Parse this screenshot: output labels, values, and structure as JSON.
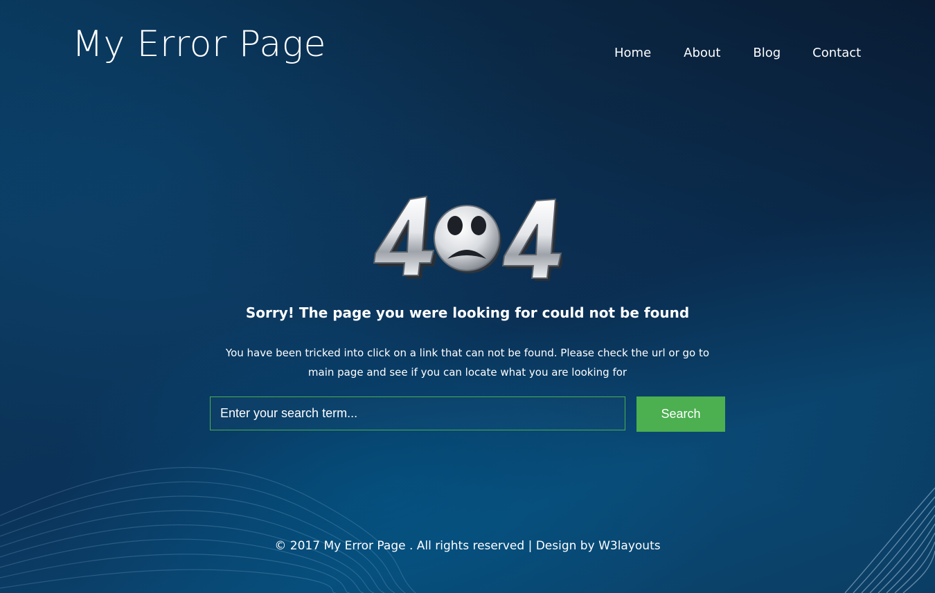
{
  "header": {
    "brand": "My Error Page",
    "nav": [
      {
        "label": "Home"
      },
      {
        "label": "About"
      },
      {
        "label": "Blog"
      },
      {
        "label": "Contact"
      }
    ]
  },
  "main": {
    "error_graphic": {
      "text": "404",
      "icon": "sad-face-icon"
    },
    "heading": "Sorry! The page you were looking for could not be found",
    "description": "You have been tricked into click on a link that can not be found. Please check the url or go to main page and see if you can locate what you are looking for",
    "search": {
      "placeholder": "Enter your search term...",
      "value": "",
      "button_label": "Search"
    }
  },
  "footer": {
    "text": "© 2017 My Error Page . All rights reserved | Design by W3layouts"
  },
  "colors": {
    "background": "#0b3a60",
    "accent": "#4caf50",
    "text": "#ffffff"
  }
}
